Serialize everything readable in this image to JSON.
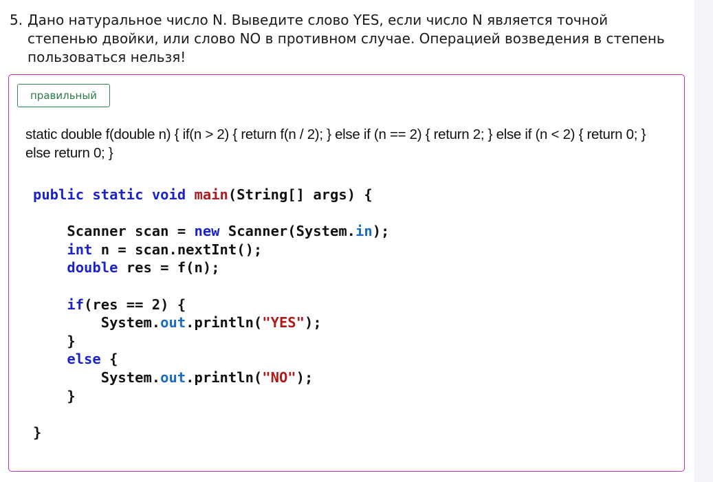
{
  "question": {
    "number": "5.",
    "text": "Дано натуральное число N. Выведите слово YES, если число N является точной степенью двойки, или слово NO в противном случае. Операцией возведения в степень пользоваться нельзя!"
  },
  "answer": {
    "badge": "правильный",
    "function_text": "static double f(double n) { if(n > 2) { return f(n / 2); } else if (n == 2) { return 2; } else if (n < 2) { return 0; } else return 0; }",
    "code": {
      "l1_kw1": "public",
      "l1_kw2": "static",
      "l1_kw3": "void",
      "l1_fn": "main",
      "l1_rest": "(String[] args) {",
      "l3_a": "    Scanner scan = ",
      "l3_kw": "new",
      "l3_b": " Scanner(System.",
      "l3_fld": "in",
      "l3_c": ");",
      "l4_kw": "int",
      "l4_rest": " n = scan.nextInt();",
      "l5_kw": "double",
      "l5_rest": " res = f(n);",
      "l7_kw": "if",
      "l7_rest": "(res == 2) {",
      "l8_a": "        System.",
      "l8_fld": "out",
      "l8_b": ".println(",
      "l8_str": "\"YES\"",
      "l8_c": ");",
      "l9": "    }",
      "l10_kw": "else",
      "l10_rest": " {",
      "l11_a": "        System.",
      "l11_fld": "out",
      "l11_b": ".println(",
      "l11_str": "\"NO\"",
      "l11_c": ");",
      "l12": "    }",
      "l14": "}"
    }
  },
  "colors": {
    "box_border": "#c22bb6",
    "badge_border": "#2f8b4e",
    "keyword": "#1a22c8",
    "method_name": "#b01a1a",
    "field": "#1a6ac8",
    "string": "#b01a1a"
  }
}
